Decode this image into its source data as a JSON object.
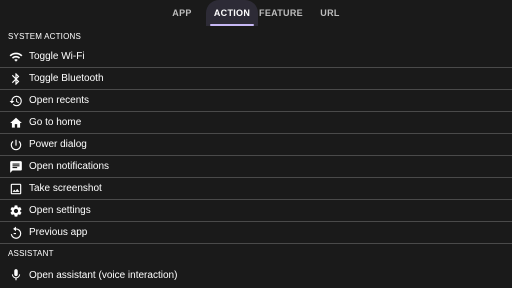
{
  "tabs": [
    {
      "label": "APP",
      "active": false
    },
    {
      "label": "ACTION",
      "active": true
    },
    {
      "label": "FEATURE",
      "active": false
    },
    {
      "label": "URL",
      "active": false
    }
  ],
  "sections": {
    "system": {
      "title": "SYSTEM ACTIONS",
      "items": [
        {
          "label": "Toggle Wi-Fi",
          "icon": "wifi-icon"
        },
        {
          "label": "Toggle Bluetooth",
          "icon": "bluetooth-icon"
        },
        {
          "label": "Open recents",
          "icon": "history-icon"
        },
        {
          "label": "Go to home",
          "icon": "home-icon"
        },
        {
          "label": "Power dialog",
          "icon": "power-icon"
        },
        {
          "label": "Open notifications",
          "icon": "notification-message-icon"
        },
        {
          "label": "Take screenshot",
          "icon": "screenshot-image-icon"
        },
        {
          "label": "Open settings",
          "icon": "gear-icon"
        },
        {
          "label": "Previous app",
          "icon": "previous-app-icon"
        }
      ]
    },
    "assistant": {
      "title": "ASSISTANT",
      "items": [
        {
          "label": "Open assistant (voice interaction)",
          "icon": "microphone-icon"
        }
      ]
    }
  },
  "colors": {
    "background": "#1a1a1a",
    "active_tab_bg": "#2d2b36",
    "indicator": "#c7b8f5",
    "divider": "#4a4a4a"
  }
}
